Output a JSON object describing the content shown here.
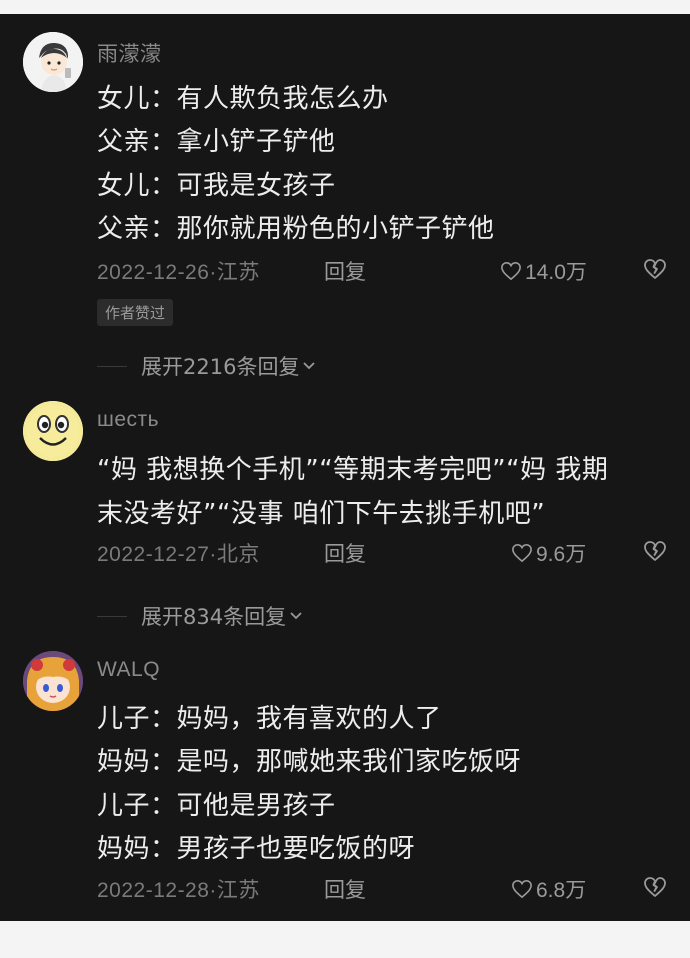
{
  "comments": [
    {
      "username": "雨濛濛",
      "lines": [
        "女儿：有人欺负我怎么办",
        "父亲：拿小铲子铲他",
        "女儿：可我是女孩子",
        "父亲：那你就用粉色的小铲子铲他"
      ],
      "date_location": "2022-12-26·江苏",
      "reply_label": "回复",
      "likes": "14.0万",
      "badge": "作者赞过",
      "expand_label": "展开2216条回复"
    },
    {
      "username": "шесть",
      "lines": [
        "“妈 我想换个手机”“等期末考完吧”“妈 我期",
        "末没考好”“没事 咱们下午去挑手机吧”"
      ],
      "date_location": "2022-12-27·北京",
      "reply_label": "回复",
      "likes": "9.6万",
      "expand_label": "展开834条回复"
    },
    {
      "username": "WALQ",
      "lines": [
        "儿子：妈妈，我有喜欢的人了",
        "妈妈：是吗，那喊她来我们家吃饭呀",
        "儿子：可他是男孩子",
        "妈妈：男孩子也要吃饭的呀"
      ],
      "date_location": "2022-12-28·江苏",
      "reply_label": "回复",
      "likes": "6.8万"
    }
  ],
  "colors": {
    "background": "#161616",
    "text": "#ededed",
    "muted": "#8a8a8a"
  },
  "icons": [
    "heart-outline-icon",
    "broken-heart-icon",
    "chevron-down-icon"
  ]
}
